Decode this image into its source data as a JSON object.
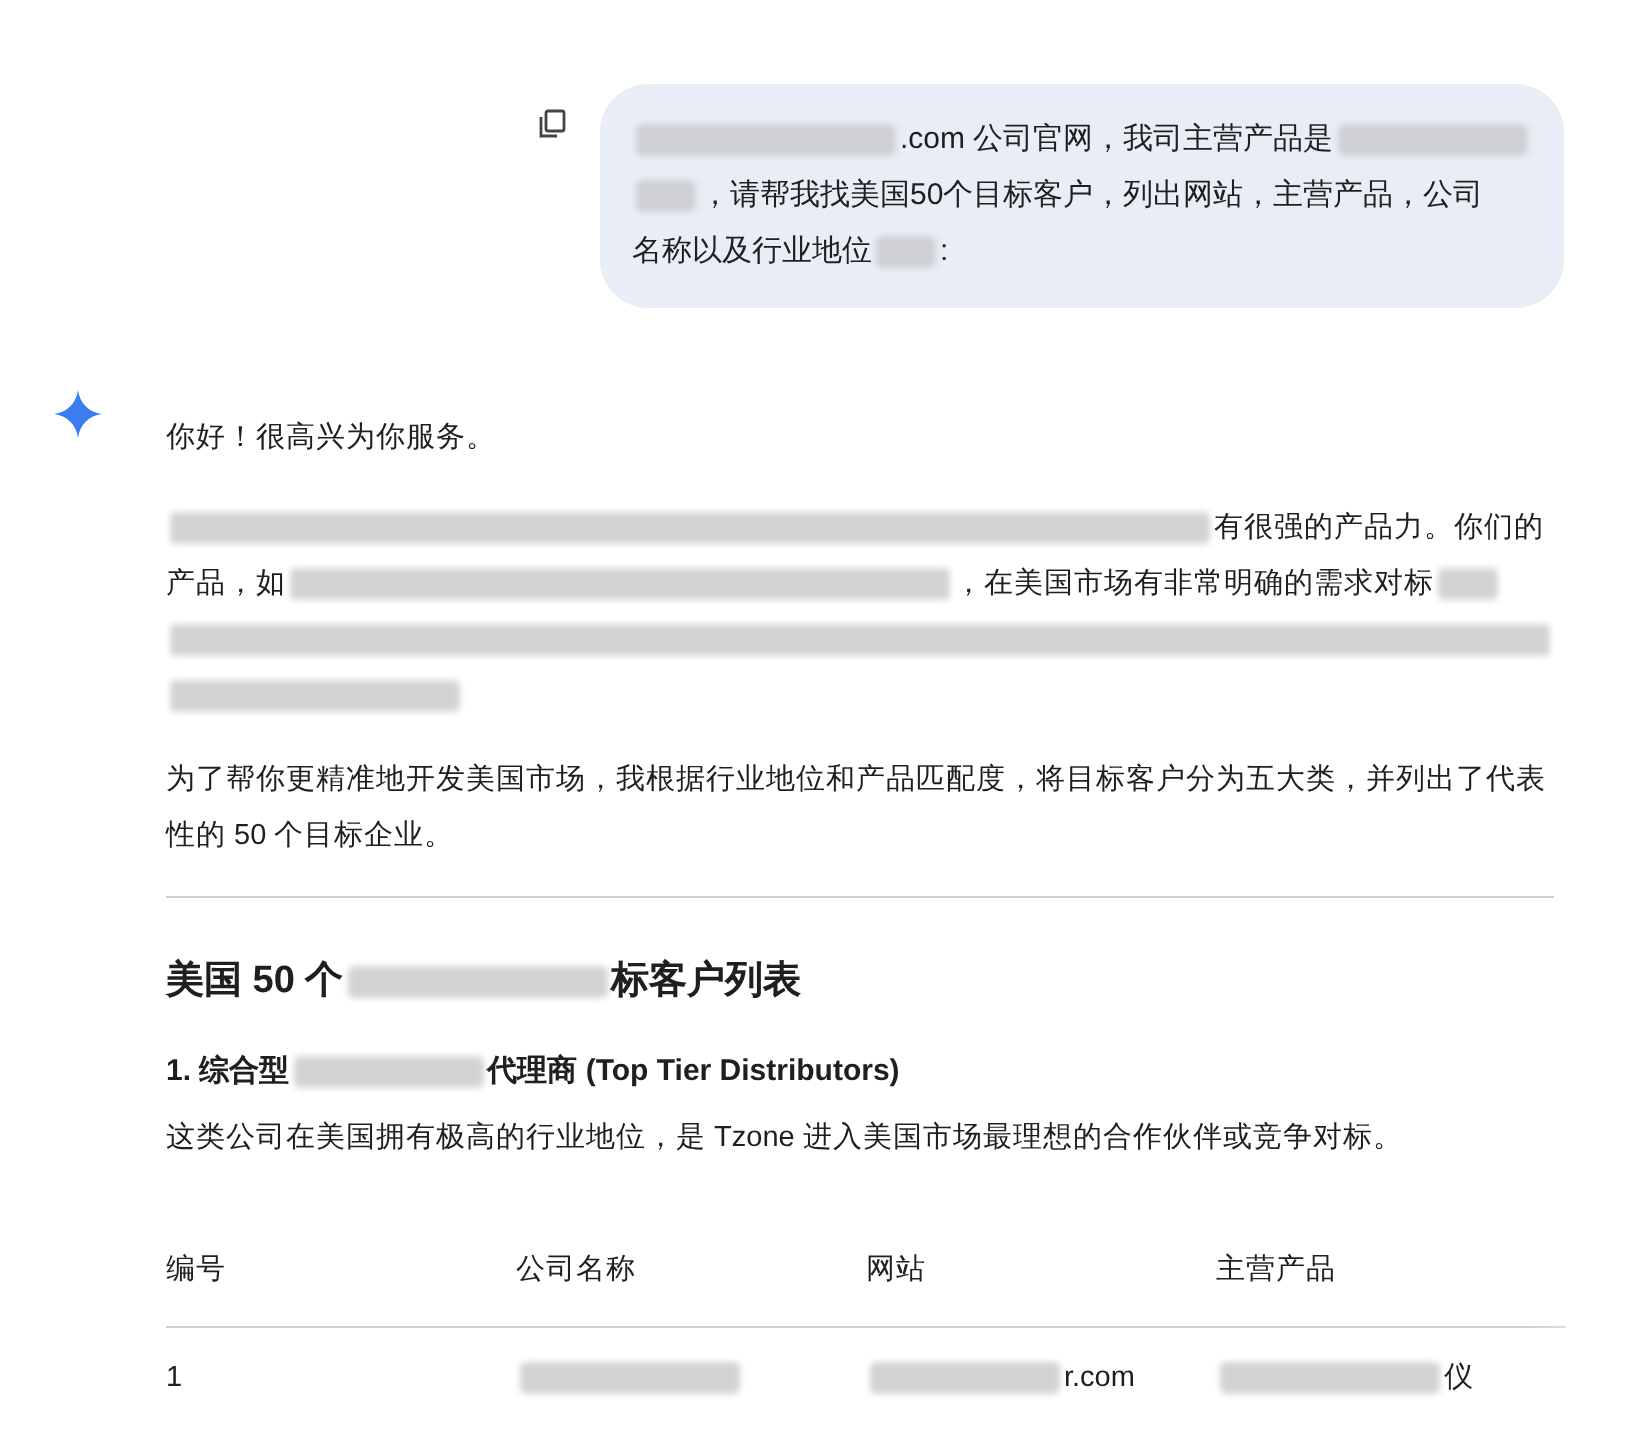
{
  "user_message": {
    "lines": [
      [
        {
          "kind": "redacted"
        },
        {
          "kind": "text",
          "text": ".com 公司官网，我司主营产品是"
        },
        {
          "kind": "redacted"
        }
      ],
      [
        {
          "kind": "redacted"
        },
        {
          "kind": "text",
          "text": "，请帮我找美国50个目标客户，列出网站，主营产品，公司"
        }
      ],
      [
        {
          "kind": "text",
          "text": "名称以及行业地位"
        },
        {
          "kind": "redacted"
        },
        {
          "kind": "text",
          "text": ":"
        }
      ]
    ]
  },
  "response": {
    "greeting": "你好！很高兴为你服务。",
    "intro": [
      {
        "kind": "redacted"
      },
      {
        "kind": "text",
        "text": "有很强的产品力。你们的产品，如"
      },
      {
        "kind": "redacted"
      },
      {
        "kind": "text",
        "text": "，在美国市场有非常明确的需求对标"
      },
      {
        "kind": "redacted"
      },
      {
        "kind": "redacted"
      },
      {
        "kind": "redacted"
      }
    ],
    "summary": "为了帮你更精准地开发美国市场，我根据行业地位和产品匹配度，将目标客户分为五大类，并列出了代表性的 50 个目标企业。",
    "heading": [
      {
        "kind": "text",
        "text": "美国 50 个"
      },
      {
        "kind": "redacted"
      },
      {
        "kind": "text",
        "text": "标客户列表"
      }
    ],
    "section": {
      "title": [
        {
          "kind": "text",
          "text": "1. 综合型"
        },
        {
          "kind": "redacted"
        },
        {
          "kind": "text",
          "text": "代理商 (Top Tier Distributors)"
        }
      ],
      "description": "这类公司在美国拥有极高的行业地位，是 Tzone 进入美国市场最理想的合作伙伴或竞争对标。"
    },
    "table": {
      "columns": [
        "编号",
        "公司名称",
        "网站",
        "主营产品"
      ],
      "rows": [
        [
          [
            {
              "kind": "text",
              "text": "1"
            }
          ],
          [
            {
              "kind": "redacted"
            }
          ],
          [
            {
              "kind": "redacted"
            },
            {
              "kind": "text",
              "text": "r.com"
            }
          ],
          [
            {
              "kind": "redacted"
            },
            {
              "kind": "text",
              "text": "仪"
            }
          ]
        ]
      ]
    }
  }
}
